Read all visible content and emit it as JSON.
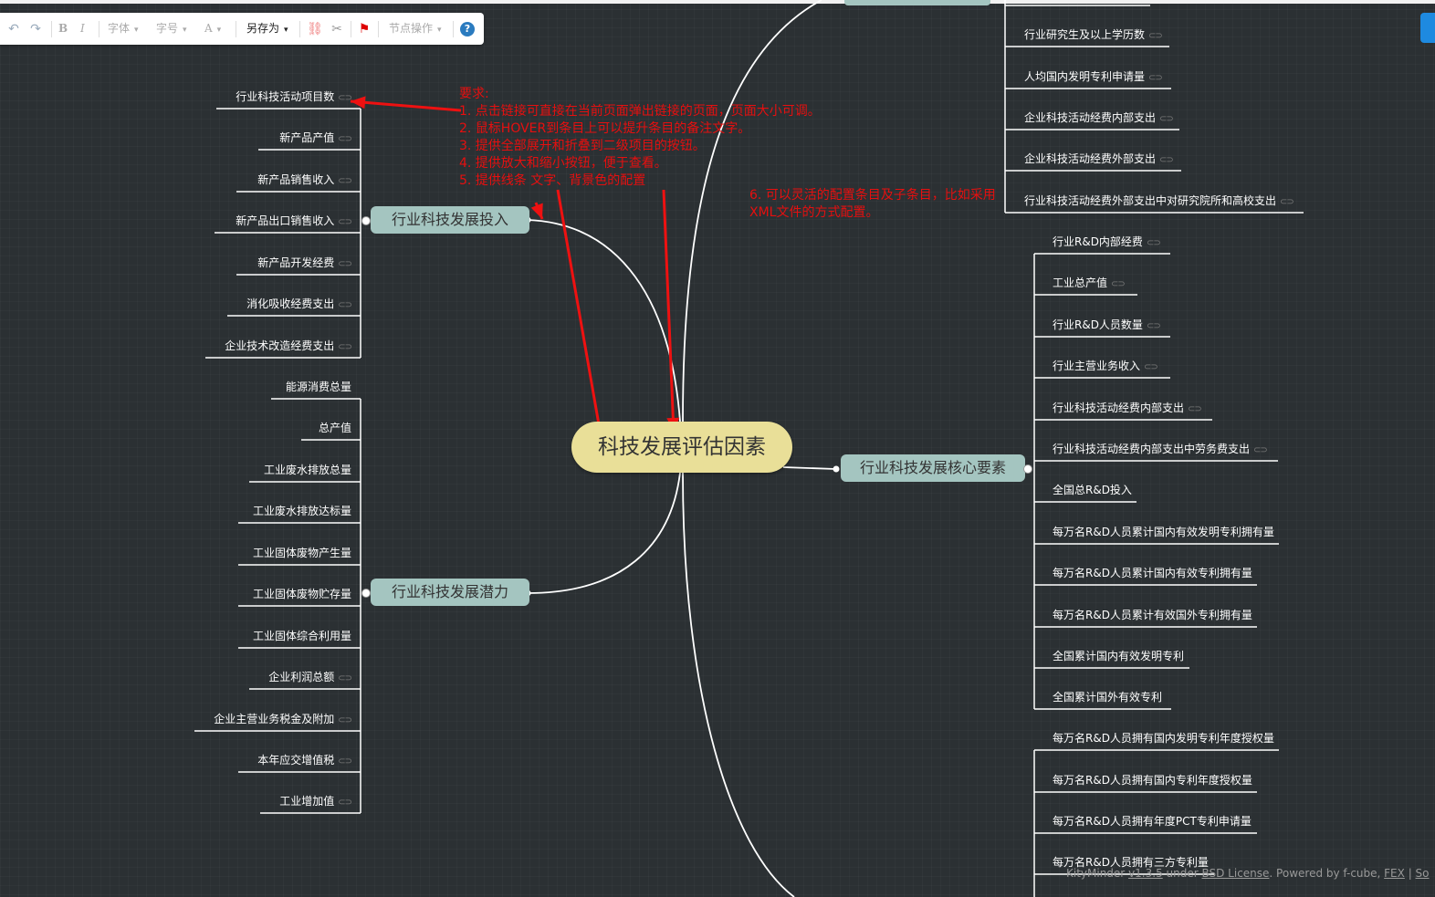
{
  "toolbar": {
    "undo_icon": "undo-icon",
    "redo_icon": "redo-icon",
    "bold": "B",
    "italic": "I",
    "font_family": "字体",
    "font_size": "字号",
    "font_color": "A",
    "save_as": "另存为",
    "link_icon": "link-icon",
    "unlink_icon": "unlink-icon",
    "priority_icon": "flag-icon",
    "node_ops": "节点操作",
    "help_icon": "help-icon"
  },
  "root": {
    "label": "科技发展评估因素"
  },
  "branches": {
    "investment": {
      "label": "行业科技发展投入"
    },
    "potential": {
      "label": "行业科技发展潜力"
    },
    "core": {
      "label": "行业科技发展核心要素"
    }
  },
  "investment_items": [
    "行业科技活动项目数",
    "新产品产值",
    "新产品销售收入",
    "新产品出口销售收入",
    "新产品开发经费",
    "消化吸收经费支出",
    "企业技术改造经费支出"
  ],
  "potential_items": [
    "能源消费总量",
    "总产值",
    "工业废水排放总量",
    "工业废水排放达标量",
    "工业固体废物产生量",
    "工业固体废物贮存量",
    "工业固体综合利用量",
    "企业利润总额",
    "企业主营业务税金及附加",
    "本年应交增值税",
    "工业增加值"
  ],
  "top_right_items": [
    "行业研究生及以上学历数",
    "人均国内发明专利申请量",
    "企业科技活动经费内部支出",
    "企业科技活动经费外部支出",
    "行业科技活动经费外部支出中对研究院所和高校支出"
  ],
  "core_items": [
    "行业R&D内部经费",
    "工业总产值",
    "行业R&D人员数量",
    "行业主营业务收入",
    "行业科技活动经费内部支出",
    "行业科技活动经费内部支出中劳务费支出",
    "全国总R&D投入",
    "每万名R&D人员累计国内有效发明专利拥有量",
    "每万名R&D人员累计国内有效专利拥有量",
    "每万名R&D人员累计有效国外专利拥有量",
    "全国累计国内有效发明专利",
    "全国累计国外有效专利"
  ],
  "bottom_right_items": [
    "每万名R&D人员拥有国内发明专利年度授权量",
    "每万名R&D人员拥有国内专利年度授权量",
    "每万名R&D人员拥有年度PCT专利申请量",
    "每万名R&D人员拥有三方专利量"
  ],
  "notes": {
    "requirements": [
      "要求:",
      "1. 点击链接可直接在当前页面弹出链接的页面，页面大小可调。",
      "2. 鼠标HOVER到条目上可以提升条目的备注文字。",
      "3. 提供全部展开和折叠到二级项目的按钮。",
      "4. 提供放大和缩小按钮，便于查看。",
      "5. 提供线条 文字、背景色的配置"
    ],
    "extra": [
      "6. 可以灵活的配置条目及子条目，比如采用",
      "XML文件的方式配置。"
    ]
  },
  "footer": {
    "prefix": "KityMinder ",
    "version": "v1.3.5",
    "under": " under ",
    "license": "BSD License",
    "powered": ". Powered by f-cube, ",
    "fex": "FEX",
    "sep": " | ",
    "so": "So"
  },
  "colors": {
    "background": "#2b3033",
    "root_fill": "#e9df98",
    "branch_fill": "#a4c5c0",
    "note_red": "#e60f0f",
    "edge": "#ffffff"
  }
}
